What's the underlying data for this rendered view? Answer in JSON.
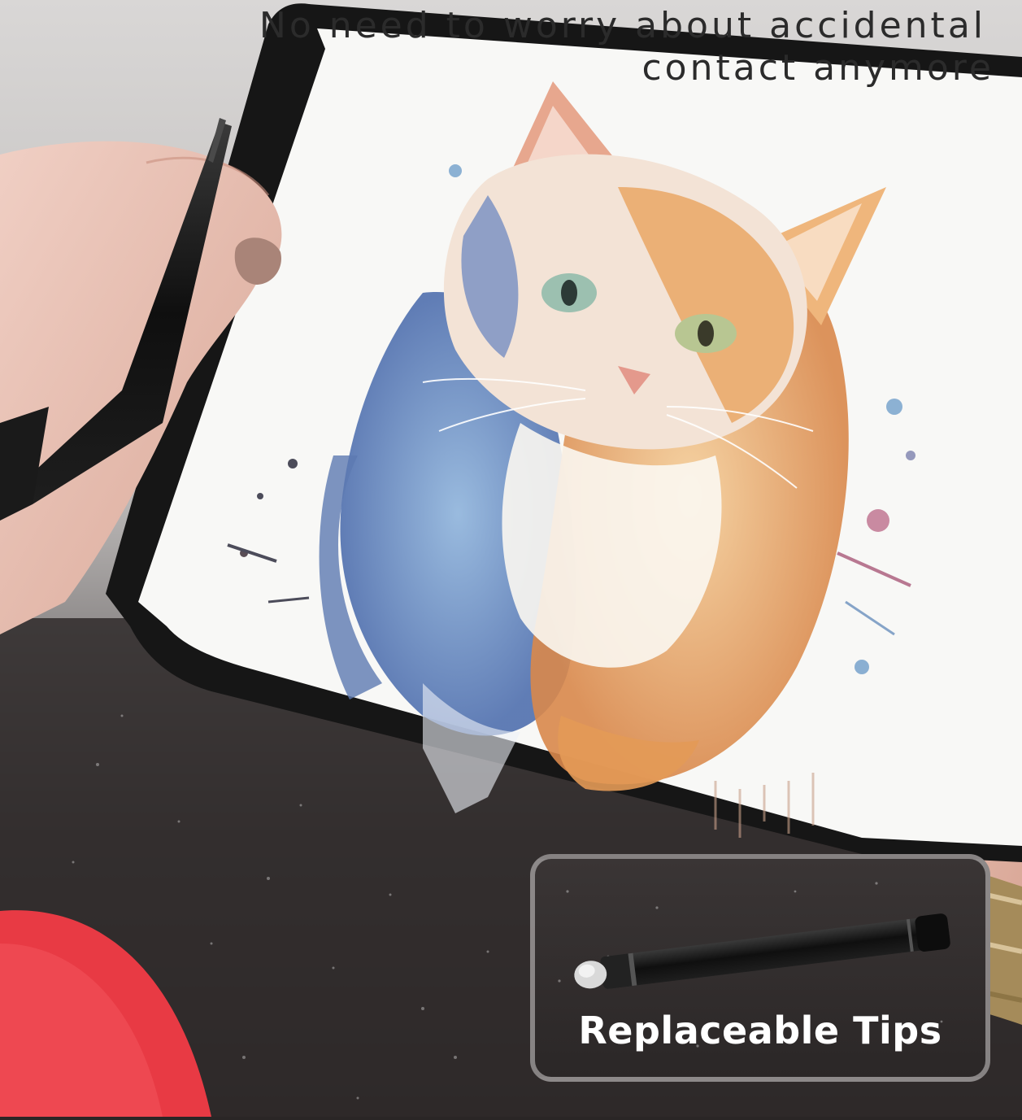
{
  "headline": {
    "line1": "No need to worry about accidental",
    "line2": "contact anymore"
  },
  "inset": {
    "caption": "Replaceable Tips"
  },
  "colors": {
    "headline_text": "#2b2b2b",
    "caption_text": "#ffffff",
    "tablet_bezel": "#161616",
    "screen": "#f8f8f6"
  }
}
